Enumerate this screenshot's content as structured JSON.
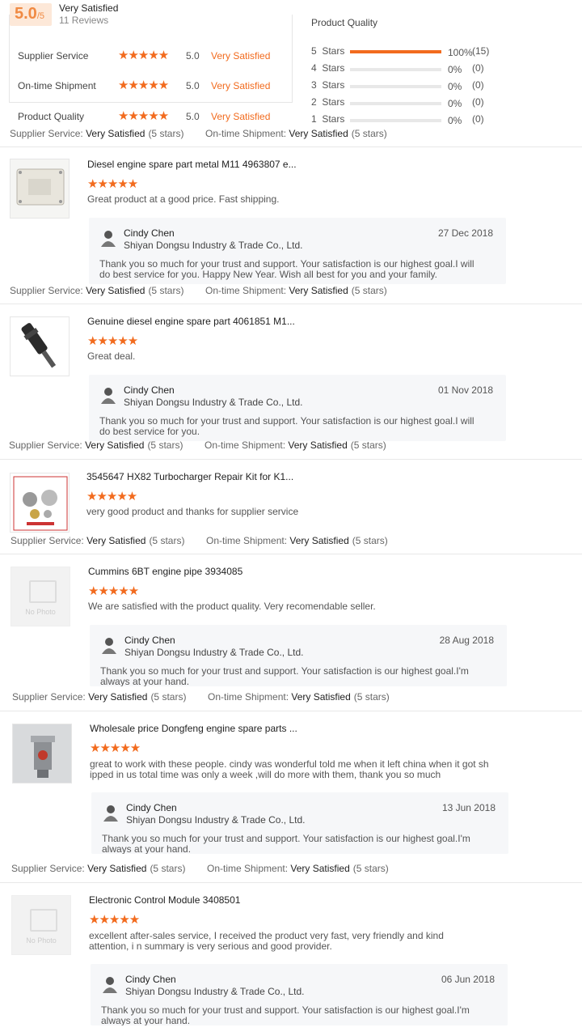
{
  "summary": {
    "score": "5.0",
    "score_suffix": "/5",
    "title": "Very Satisfied",
    "review_count": "11 Reviews",
    "categories": [
      {
        "label": "Supplier Service",
        "score": "5.0",
        "sat": "Very Satisfied"
      },
      {
        "label": "On-time Shipment",
        "score": "5.0",
        "sat": "Very Satisfied"
      },
      {
        "label": "Product Quality",
        "score": "5.0",
        "sat": "Very Satisfied"
      }
    ],
    "pq_title": "Product Quality",
    "bars": [
      {
        "label": "5  Stars",
        "fill": 1.0,
        "pct": "100%",
        "count": "(15)"
      },
      {
        "label": "4  Stars",
        "fill": 0,
        "pct": "0%",
        "count": "(0)"
      },
      {
        "label": "3  Stars",
        "fill": 0,
        "pct": "0%",
        "count": "(0)"
      },
      {
        "label": "2  Stars",
        "fill": 0,
        "pct": "0%",
        "count": "(0)"
      },
      {
        "label": "1  Stars",
        "fill": 0,
        "pct": "0%",
        "count": "(0)"
      }
    ]
  },
  "meta_labels": {
    "supplier": "Supplier Service:",
    "shipment": "On-time Shipment:",
    "sat": "Very Satisfied",
    "paren": "(5 stars)"
  },
  "star_glyphs": "★★★★★",
  "reviews": [
    {
      "title": "Diesel engine spare part metal M11 4963807 e...",
      "text": "Great product at a good price. Fast shipping.",
      "reply": {
        "name": "Cindy Chen",
        "company": "Shiyan Dongsu Industry & Trade Co., Ltd.",
        "date": "27 Dec 2018",
        "text": "Thank you so much for your trust and support. Your satisfaction is our highest goal.I will do best service for you. Happy New Year. Wish all best for you and your family."
      }
    },
    {
      "title": "Genuine diesel engine spare part 4061851 M1...",
      "text": "Great deal.",
      "reply": {
        "name": "Cindy Chen",
        "company": "Shiyan Dongsu Industry & Trade Co., Ltd.",
        "date": "01 Nov 2018",
        "text": "Thank you so much for your trust and support. Your satisfaction is our highest goal.I will do best service for you."
      }
    },
    {
      "title": "3545647 HX82 Turbocharger Repair Kit for K1...",
      "text": "very good product and thanks for supplier service"
    },
    {
      "title": "Cummins 6BT engine pipe 3934085",
      "text": "We are satisfied with the product quality. Very recomendable seller.",
      "thumb_text": "No Photo",
      "reply": {
        "name": "Cindy Chen",
        "company": "Shiyan Dongsu Industry & Trade Co., Ltd.",
        "date": "28 Aug 2018",
        "text": "Thank you so much for your trust and support. Your satisfaction is our highest goal.I'm always at your hand."
      }
    },
    {
      "title": "Wholesale price Dongfeng engine spare parts ...",
      "text": "great to work with these people. cindy was wonderful told me when it left china when it got sh ipped in us total time was only a week ,will do more with them, thank you so much",
      "reply": {
        "name": "Cindy Chen",
        "company": "Shiyan Dongsu Industry & Trade Co., Ltd.",
        "date": "13 Jun 2018",
        "text": "Thank you so much for your trust and support. Your satisfaction is our highest goal.I'm always at your hand."
      }
    },
    {
      "title": "Electronic Control Module 3408501",
      "text": "excellent after-sales service, I received the product very fast, very friendly and kind attention, i n summary is very serious and good provider.",
      "thumb_text": "No Photo",
      "reply": {
        "name": "Cindy Chen",
        "company": "Shiyan Dongsu Industry & Trade Co., Ltd.",
        "date": "06 Jun 2018",
        "text": "Thank you so much for your trust and support. Your satisfaction is our highest goal.I'm always at your hand."
      }
    }
  ]
}
